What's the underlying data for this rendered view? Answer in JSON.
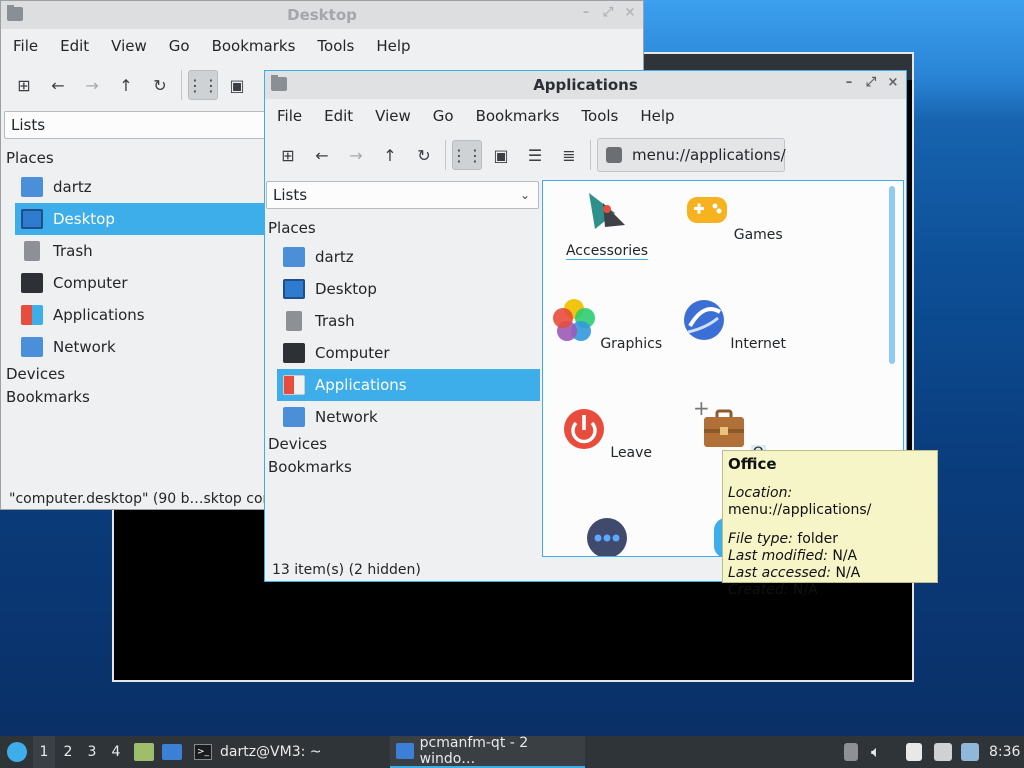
{
  "colors": {
    "accent": "#3daee9",
    "selection": "#3daee9",
    "tooltip_bg": "#f5f5c8",
    "taskbar": "#2f3438"
  },
  "back_window": {
    "title": "Desktop",
    "menu": [
      "File",
      "Edit",
      "View",
      "Go",
      "Bookmarks",
      "Tools",
      "Help"
    ],
    "toolbar_icons": [
      "new-tab-icon",
      "back-icon",
      "forward-icon",
      "up-icon",
      "reload-icon",
      "icon-view-icon",
      "thumbnail-view-icon"
    ],
    "side_mode": "Lists",
    "places_header": "Places",
    "places": [
      {
        "label": "dartz",
        "icon": "home-folder-icon"
      },
      {
        "label": "Desktop",
        "icon": "desktop-icon",
        "selected": true
      },
      {
        "label": "Trash",
        "icon": "trash-icon"
      },
      {
        "label": "Computer",
        "icon": "computer-icon"
      },
      {
        "label": "Applications",
        "icon": "applications-icon"
      },
      {
        "label": "Network",
        "icon": "network-icon"
      }
    ],
    "devices_header": "Devices",
    "bookmarks_header": "Bookmarks",
    "status": "\"computer.desktop\" (90 b…sktop con"
  },
  "front_window": {
    "title": "Applications",
    "window_buttons": [
      "–",
      "⤢",
      "×"
    ],
    "menu": [
      "File",
      "Edit",
      "View",
      "Go",
      "Bookmarks",
      "Tools",
      "Help"
    ],
    "path": "menu://applications/",
    "side_mode": "Lists",
    "places_header": "Places",
    "places": [
      {
        "label": "dartz",
        "icon": "home-folder-icon"
      },
      {
        "label": "Desktop",
        "icon": "desktop-icon"
      },
      {
        "label": "Trash",
        "icon": "trash-icon"
      },
      {
        "label": "Computer",
        "icon": "computer-icon"
      },
      {
        "label": "Applications",
        "icon": "applications-icon",
        "selected": true
      },
      {
        "label": "Network",
        "icon": "network-icon"
      }
    ],
    "devices_header": "Devices",
    "bookmarks_header": "Bookmarks",
    "items": [
      {
        "label": "Accessories",
        "icon": "accessories-icon"
      },
      {
        "label": "Games",
        "icon": "games-icon"
      },
      {
        "label": "Graphics",
        "icon": "graphics-icon"
      },
      {
        "label": "Internet",
        "icon": "internet-icon"
      },
      {
        "label": "Leave",
        "icon": "leave-icon"
      },
      {
        "label": "O",
        "icon": "office-icon"
      },
      {
        "label": "",
        "icon": "more-icon"
      },
      {
        "label": "",
        "icon": "other-icon"
      }
    ],
    "status": "13 item(s) (2 hidden)"
  },
  "tooltip": {
    "title": "Office",
    "location_label": "Location:",
    "location_value": "menu://applications/",
    "filetype_label": "File type:",
    "filetype_value": "folder",
    "modified_label": "Last modified:",
    "modified_value": "N/A",
    "accessed_label": "Last accessed:",
    "accessed_value": "N/A",
    "created_label": "Created:",
    "created_value": "N/A"
  },
  "taskbar": {
    "workspaces": [
      "1",
      "2",
      "3",
      "4"
    ],
    "terminal_task": "dartz@VM3: ~",
    "filemanager_task": "pcmanfm-qt - 2 windo…",
    "clock": "8:36"
  }
}
